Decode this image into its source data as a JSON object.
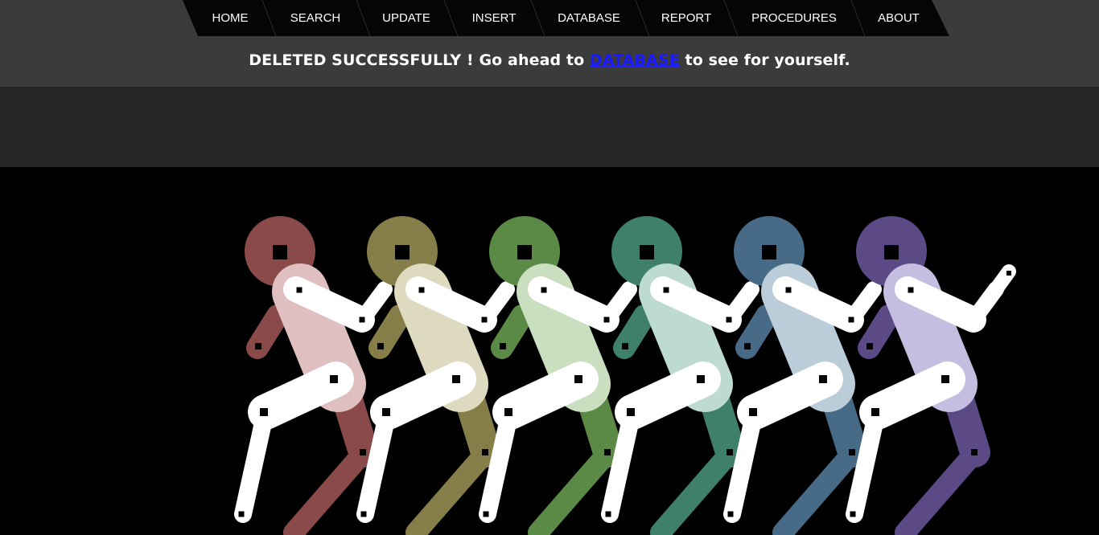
{
  "nav": {
    "items": [
      {
        "label": "HOME",
        "name": "nav-home"
      },
      {
        "label": "SEARCH",
        "name": "nav-search"
      },
      {
        "label": "UPDATE",
        "name": "nav-update"
      },
      {
        "label": "INSERT",
        "name": "nav-insert"
      },
      {
        "label": "DATABASE",
        "name": "nav-database"
      },
      {
        "label": "REPORT",
        "name": "nav-report"
      },
      {
        "label": "PROCEDURES",
        "name": "nav-procedures"
      },
      {
        "label": "ABOUT",
        "name": "nav-about"
      }
    ]
  },
  "message": {
    "prefix": "DELETED SUCCESSFULLY ! Go ahead to ",
    "link": "DATABASE",
    "suffix": " to see for yourself."
  },
  "animation": {
    "figures": [
      {
        "name": "figure-red",
        "head": "#8a4a4a",
        "torso": "#dfbfc0",
        "legs": "#8a4a4a"
      },
      {
        "name": "figure-olive",
        "head": "#857e48",
        "torso": "#dedac0",
        "legs": "#857e48"
      },
      {
        "name": "figure-green",
        "head": "#5a8a46",
        "torso": "#c9dfbf",
        "legs": "#5a8a46"
      },
      {
        "name": "figure-teal",
        "head": "#3f806a",
        "torso": "#bddccf",
        "legs": "#3f806a"
      },
      {
        "name": "figure-blue",
        "head": "#476a86",
        "torso": "#bccdda",
        "legs": "#476a86"
      },
      {
        "name": "figure-purple",
        "head": "#5c4a86",
        "torso": "#c6bee0",
        "legs": "#5c4a86"
      }
    ]
  }
}
